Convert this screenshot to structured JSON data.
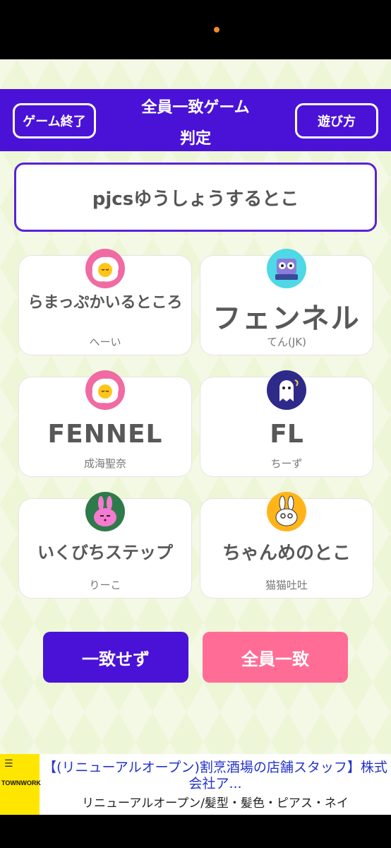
{
  "header": {
    "end_button": "ゲーム終了",
    "title_line1": "全員一致ゲーム",
    "title_line2": "判定",
    "howto_button": "遊び方",
    "color": "#4a12d6"
  },
  "topic": "pjcsゆうしょうするとこ",
  "answers": [
    {
      "answer": "らまっぷかいるところ",
      "player": "へーい",
      "icon": "fried-egg-icon"
    },
    {
      "answer": "フェンネル",
      "player": "てん(JK)",
      "icon": "owl-book-icon"
    },
    {
      "answer": "FENNEL",
      "player": "成海聖奈",
      "icon": "fried-egg-icon"
    },
    {
      "answer": "FL",
      "player": "ちーず",
      "icon": "ghost-icon"
    },
    {
      "answer": "いくびちステップ",
      "player": "りーこ",
      "icon": "pink-rabbit-icon"
    },
    {
      "answer": "ちゃんめのとこ",
      "player": "猫猫吐吐",
      "icon": "white-rabbit-icon"
    }
  ],
  "buttons": {
    "no_match": "一致せず",
    "all_match": "全員一致",
    "no_match_color": "#4a12d6",
    "all_match_color": "#ff6d96"
  },
  "ad": {
    "brand": "TOWNWORK",
    "title": "【(リニューアルオープン)割烹酒場の店舗スタッフ】株式会社ア...",
    "description": "リニューアルオープン/髪型・髪色・ピアス・ネイ"
  }
}
